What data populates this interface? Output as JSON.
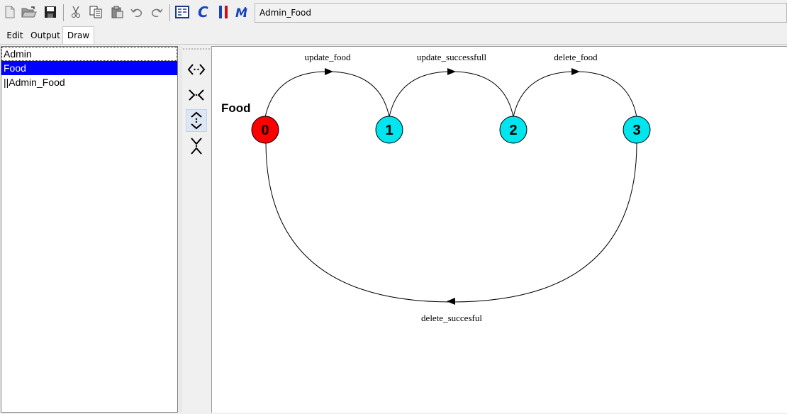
{
  "toolbar": {
    "icons": [
      "new-file-icon",
      "open-folder-icon",
      "save-icon",
      "cut-icon",
      "copy-icon",
      "paste-icon",
      "undo-icon",
      "redo-icon",
      "window-icon",
      "compile-icon",
      "parallel-compose-icon",
      "minimize-icon"
    ],
    "title": "Admin_Food"
  },
  "tabs": [
    {
      "label": "Edit"
    },
    {
      "label": "Output"
    },
    {
      "label": "Draw",
      "active": true
    }
  ],
  "process_list": [
    {
      "label": "Admin",
      "state": "focused"
    },
    {
      "label": "Food",
      "state": "selected"
    },
    {
      "label": "||Admin_Food",
      "state": "normal"
    }
  ],
  "side_tools": [
    "expand-horizontal-icon",
    "shrink-horizontal-icon",
    "expand-vertical-icon",
    "shrink-vertical-icon"
  ],
  "lts": {
    "name": "Food",
    "states": [
      {
        "id": "0",
        "color": "#ff0000",
        "initial": true
      },
      {
        "id": "1",
        "color": "#00e5ee"
      },
      {
        "id": "2",
        "color": "#00e5ee"
      },
      {
        "id": "3",
        "color": "#00e5ee"
      }
    ],
    "transitions": [
      {
        "from": "0",
        "to": "1",
        "label": "update_food"
      },
      {
        "from": "1",
        "to": "2",
        "label": "update_successfull"
      },
      {
        "from": "2",
        "to": "3",
        "label": "delete_food"
      },
      {
        "from": "3",
        "to": "0",
        "label": "delete_succesful"
      }
    ]
  }
}
